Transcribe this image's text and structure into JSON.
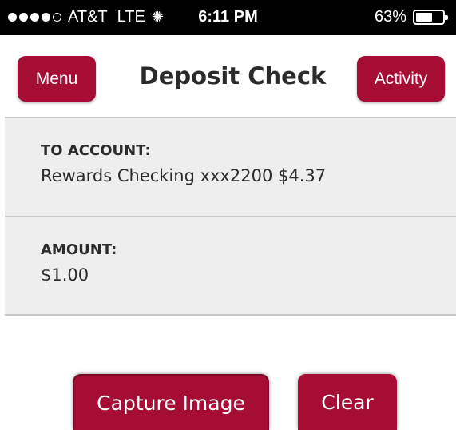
{
  "status_bar": {
    "carrier": "AT&T",
    "network": "LTE",
    "time": "6:11 PM",
    "battery_percent": "63%",
    "battery_level": 0.63,
    "signal_bars_filled": 4,
    "signal_bars_total": 5
  },
  "nav": {
    "menu_label": "Menu",
    "title": "Deposit Check",
    "activity_label": "Activity"
  },
  "form": {
    "to_account": {
      "label": "TO ACCOUNT:",
      "value": "Rewards Checking xxx2200 $4.37"
    },
    "amount": {
      "label": "AMOUNT:",
      "value": "$1.00"
    }
  },
  "actions": {
    "capture_label": "Capture Image",
    "clear_label": "Clear"
  },
  "colors": {
    "brand": "#a50d35",
    "row_background": "#efeeef",
    "text": "#2b2b2b"
  }
}
